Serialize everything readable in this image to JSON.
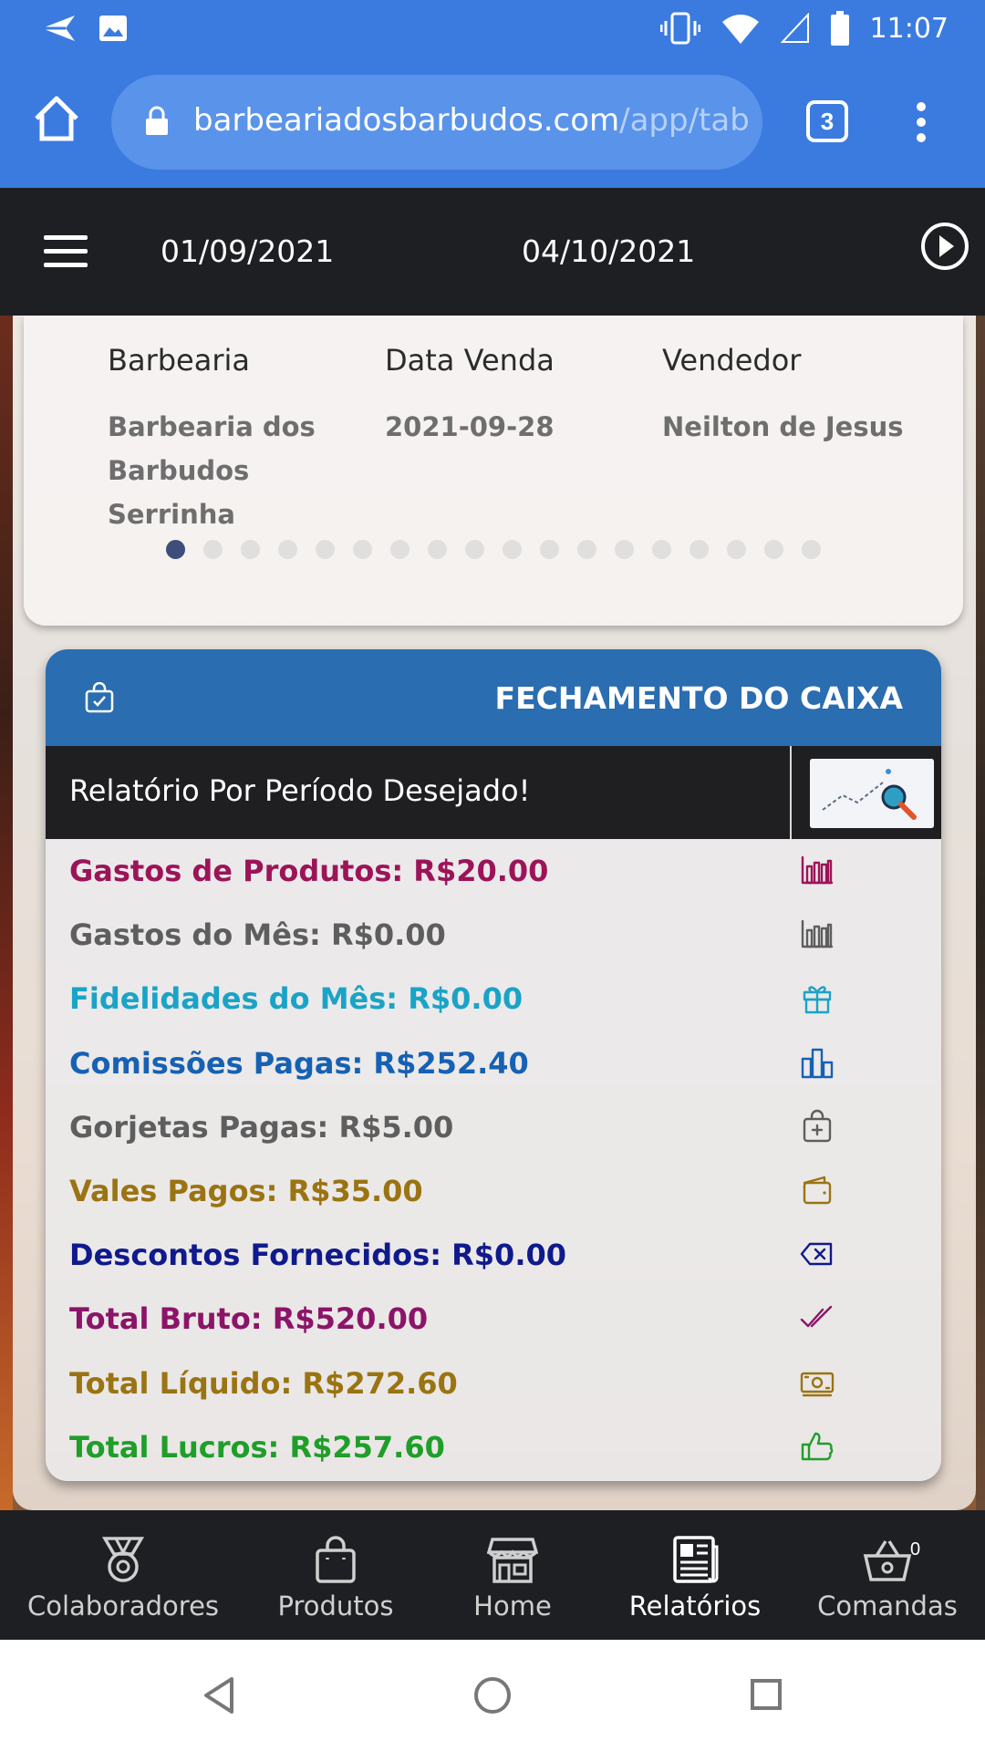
{
  "status_bar": {
    "time": "11:07"
  },
  "browser": {
    "url_host": "barbeariadosbarbudos.com",
    "url_path": "/app/tabs/",
    "tab_count": "3"
  },
  "header": {
    "date_start": "01/09/2021",
    "date_end": "04/10/2021"
  },
  "slide": {
    "columns": [
      {
        "heading": "Barbearia",
        "value": "Barbearia dos Barbudos Serrinha"
      },
      {
        "heading": "Data Venda",
        "value": "2021-09-28"
      },
      {
        "heading": "Vendedor",
        "value": "Neilton de Jesus"
      }
    ],
    "dot_count": 18,
    "active_dot": 0
  },
  "fechamento": {
    "title": "FECHAMENTO DO CAIXA",
    "subtitle": "Relatório Por Período Desejado!",
    "rows": [
      {
        "label": "Gastos de Produtos: R$20.00",
        "color": "#9c1458",
        "icon": "bar-chart-icon"
      },
      {
        "label": "Gastos do Mês: R$0.00",
        "color": "#5e5e5e",
        "icon": "bar-chart-icon"
      },
      {
        "label": "Fidelidades do Mês: R$0.00",
        "color": "#1aa3c7",
        "icon": "gift-icon"
      },
      {
        "label": "Comissões Pagas: R$252.40",
        "color": "#1661b3",
        "icon": "columns-chart-icon"
      },
      {
        "label": "Gorjetas Pagas: R$5.00",
        "color": "#5e5e5e",
        "icon": "bag-plus-icon"
      },
      {
        "label": "Vales Pagos: R$35.00",
        "color": "#9a7412",
        "icon": "wallet-icon"
      },
      {
        "label": "Descontos Fornecidos: R$0.00",
        "color": "#0f1a8c",
        "icon": "backspace-icon"
      },
      {
        "label": "Total Bruto: R$520.00",
        "color": "#8c1468",
        "icon": "double-check-icon"
      },
      {
        "label": "Total Líquido: R$272.60",
        "color": "#9a7412",
        "icon": "cash-icon"
      },
      {
        "label": "Total Lucros: R$257.60",
        "color": "#1f9e2a",
        "icon": "thumbs-up-icon"
      }
    ]
  },
  "tabbar": {
    "items": [
      {
        "label": "Colaboradores",
        "icon": "medal-icon",
        "active": false
      },
      {
        "label": "Produtos",
        "icon": "shopping-bag-icon",
        "active": false
      },
      {
        "label": "Home",
        "icon": "storefront-icon",
        "active": false
      },
      {
        "label": "Relatórios",
        "icon": "newspaper-icon",
        "active": true
      },
      {
        "label": "Comandas",
        "icon": "basket-icon",
        "active": false
      }
    ],
    "cart_badge": "0"
  }
}
